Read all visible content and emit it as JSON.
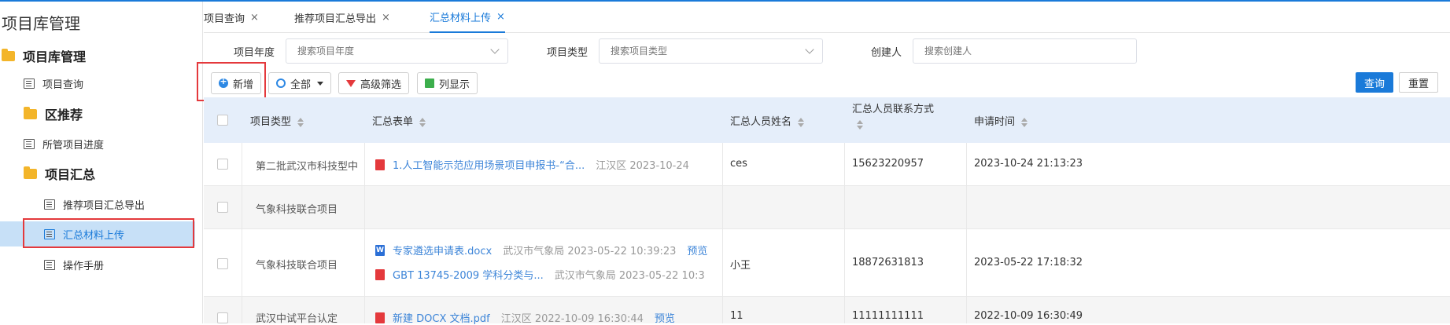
{
  "sidebar": {
    "app_title": "项目库管理",
    "group_main": "项目库管理",
    "item_query": "项目查询",
    "group_district": "区推荐",
    "item_progress": "所管项目进度",
    "group_summary": "项目汇总",
    "item_export": "推荐项目汇总导出",
    "item_upload": "汇总材料上传",
    "item_manual": "操作手册"
  },
  "tabs": [
    {
      "label": "项目查询",
      "close": "×"
    },
    {
      "label": "推荐项目汇总导出",
      "close": "×"
    },
    {
      "label": "汇总材料上传",
      "close": "×"
    }
  ],
  "filters": {
    "year_label": "项目年度",
    "year_placeholder": "搜索项目年度",
    "type_label": "项目类型",
    "type_placeholder": "搜索项目类型",
    "creator_label": "创建人",
    "creator_placeholder": "搜索创建人"
  },
  "toolbar": {
    "add": "新增",
    "all": "全部",
    "advanced": "高级筛选",
    "columns": "列显示",
    "query": "查询",
    "reset": "重置"
  },
  "table": {
    "headers": {
      "type": "项目类型",
      "form": "汇总表单",
      "name": "汇总人员姓名",
      "contact": "汇总人员联系方式",
      "time": "申请时间"
    },
    "rows": [
      {
        "type": "第二批武汉市科技型中",
        "files": [
          {
            "kind": "pdf",
            "name": "1.人工智能示范应用场景项目申报书-“合...",
            "meta": "江汉区 2023-10-24",
            "preview": ""
          }
        ],
        "name": "ces",
        "contact": "15623220957",
        "time": "2023-10-24 21:13:23"
      },
      {
        "type": "气象科技联合项目",
        "files": [],
        "name": "",
        "contact": "",
        "time": ""
      },
      {
        "type": "气象科技联合项目",
        "files": [
          {
            "kind": "word",
            "name": "专家遴选申请表.docx",
            "meta": "武汉市气象局 2023-05-22 10:39:23",
            "preview": "预览"
          },
          {
            "kind": "pdf",
            "name": "GBT 13745-2009 学科分类与...",
            "meta": "武汉市气象局 2023-05-22 10:3",
            "preview": ""
          }
        ],
        "name": "小王",
        "contact": "18872631813",
        "time": "2023-05-22 17:18:32"
      },
      {
        "type": "武汉中试平台认定",
        "files": [
          {
            "kind": "pdf",
            "name": "新建 DOCX 文档.pdf",
            "meta": "江汉区 2022-10-09 16:30:44",
            "preview": "预览"
          }
        ],
        "name": "11",
        "contact": "11111111111",
        "time": "2022-10-09 16:30:49"
      }
    ]
  },
  "colors": {
    "accent": "#1a7ad9",
    "highlight_box": "#e4393c",
    "active_nav_bg": "#c7e0f7"
  }
}
